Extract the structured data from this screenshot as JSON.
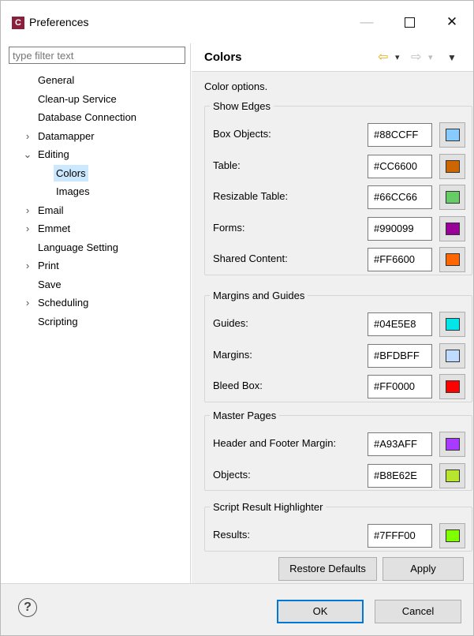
{
  "window": {
    "title": "Preferences",
    "app_icon_letter": "C",
    "minimize_glyph": "—",
    "close_glyph": "✕"
  },
  "sidebar": {
    "filter_placeholder": "type filter text",
    "items": [
      {
        "label": "General",
        "expandable": false
      },
      {
        "label": "Clean-up Service",
        "expandable": false
      },
      {
        "label": "Database Connection",
        "expandable": false
      },
      {
        "label": "Datamapper",
        "expandable": true,
        "expanded": false,
        "arrow": "›"
      },
      {
        "label": "Editing",
        "expandable": true,
        "expanded": true,
        "arrow": "⌄"
      },
      {
        "label": "Colors",
        "child": true,
        "selected": true
      },
      {
        "label": "Images",
        "child": true
      },
      {
        "label": "Email",
        "expandable": true,
        "expanded": false,
        "arrow": "›"
      },
      {
        "label": "Emmet",
        "expandable": true,
        "expanded": false,
        "arrow": "›"
      },
      {
        "label": "Language Setting",
        "expandable": false
      },
      {
        "label": "Print",
        "expandable": true,
        "expanded": false,
        "arrow": "›"
      },
      {
        "label": "Save",
        "expandable": false
      },
      {
        "label": "Scheduling",
        "expandable": true,
        "expanded": false,
        "arrow": "›"
      },
      {
        "label": "Scripting",
        "expandable": false
      }
    ]
  },
  "main": {
    "title": "Colors",
    "nav": {
      "back": "⇦",
      "forward": "⇨",
      "dropdown": "▾",
      "menu": "▼"
    },
    "description": "Color options.",
    "groups": [
      {
        "legend": "Show Edges",
        "rows": [
          {
            "label": "Box Objects:",
            "hex": "#88CCFF",
            "color": "#88CCFF"
          },
          {
            "label": "Table:",
            "hex": "#CC6600",
            "color": "#CC6600"
          },
          {
            "label": "Resizable Table:",
            "hex": "#66CC66",
            "color": "#66CC66"
          },
          {
            "label": "Forms:",
            "hex": "#990099",
            "color": "#990099"
          },
          {
            "label": "Shared Content:",
            "hex": "#FF6600",
            "color": "#FF6600"
          }
        ]
      },
      {
        "legend": "Margins and Guides",
        "rows": [
          {
            "label": "Guides:",
            "hex": "#04E5E8",
            "color": "#04E5E8"
          },
          {
            "label": "Margins:",
            "hex": "#BFDBFF",
            "color": "#BFDBFF"
          },
          {
            "label": "Bleed Box:",
            "hex": "#FF0000",
            "color": "#FF0000"
          }
        ]
      },
      {
        "legend": "Master Pages",
        "rows": [
          {
            "label": "Header and Footer Margin:",
            "hex": "#A93AFF",
            "color": "#A93AFF"
          },
          {
            "label": "Objects:",
            "hex": "#B8E62E",
            "color": "#B8E62E"
          }
        ]
      },
      {
        "legend": "Script Result Highlighter",
        "rows": [
          {
            "label": "Results:",
            "hex": "#7FFF00",
            "color": "#7FFF00"
          }
        ]
      }
    ],
    "restore_defaults_label": "Restore Defaults",
    "apply_label": "Apply"
  },
  "footer": {
    "help_glyph": "?",
    "ok_label": "OK",
    "cancel_label": "Cancel"
  }
}
